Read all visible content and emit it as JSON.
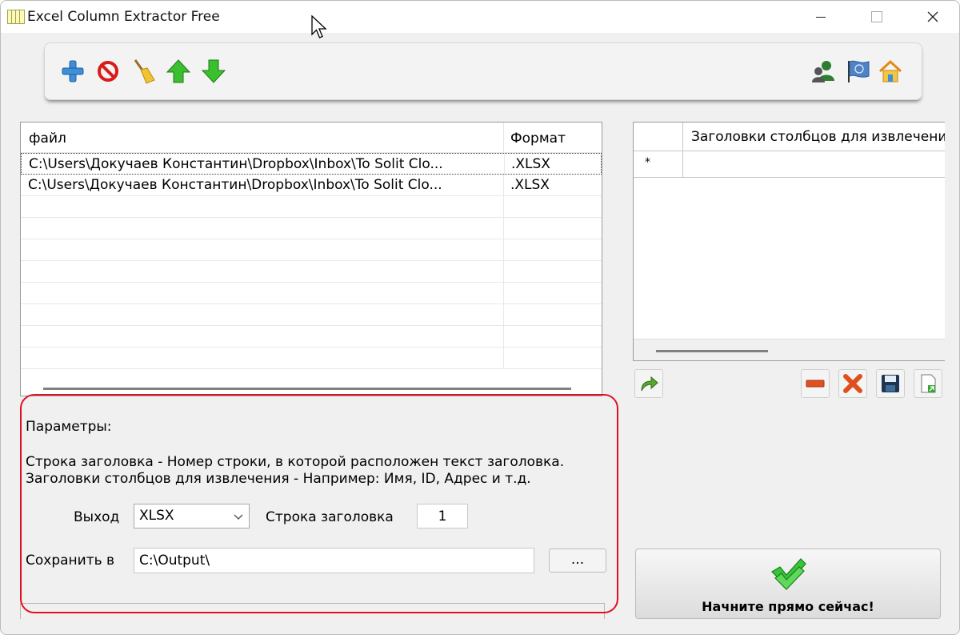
{
  "window": {
    "title": "Excel Column Extractor Free"
  },
  "toolbar": {
    "left_icons": [
      "plus-icon",
      "stop-icon",
      "broom-icon",
      "up-arrow-icon",
      "down-arrow-icon"
    ],
    "right_icons": [
      "users-icon",
      "flag-icon",
      "home-icon"
    ]
  },
  "file_list": {
    "columns": [
      "файл",
      "Формат"
    ],
    "rows": [
      {
        "file": "C:\\Users\\Докучаев Константин\\Dropbox\\Inbox\\To Solit Clo...",
        "format": ".XLSX"
      },
      {
        "file": "C:\\Users\\Докучаев Константин\\Dropbox\\Inbox\\To Solit Clo...",
        "format": ".XLSX"
      }
    ]
  },
  "params": {
    "title": "Параметры:",
    "desc_line1": "Строка заголовка - Номер строки, в которой расположен текст заголовка.",
    "desc_line2": "Заголовки столбцов для извлечения - Например: Имя, ID, Адрес и т.д.",
    "output_label": "Выход",
    "output_value": "XLSX",
    "header_row_label": "Строка заголовка",
    "header_row_value": "1",
    "save_label": "Сохранить в",
    "save_path": "C:\\Output\\",
    "browse_label": "..."
  },
  "columns_grid": {
    "header": "Заголовки столбцов для извлечения",
    "new_row_marker": "*"
  },
  "grid_actions": [
    "export-arrow-icon",
    "remove-icon",
    "delete-icon",
    "save-icon",
    "load-icon"
  ],
  "start_button": {
    "label": "Начните прямо сейчас!"
  },
  "colors": {
    "highlight_border": "#e01020",
    "window_bg": "#f0f0f0"
  }
}
